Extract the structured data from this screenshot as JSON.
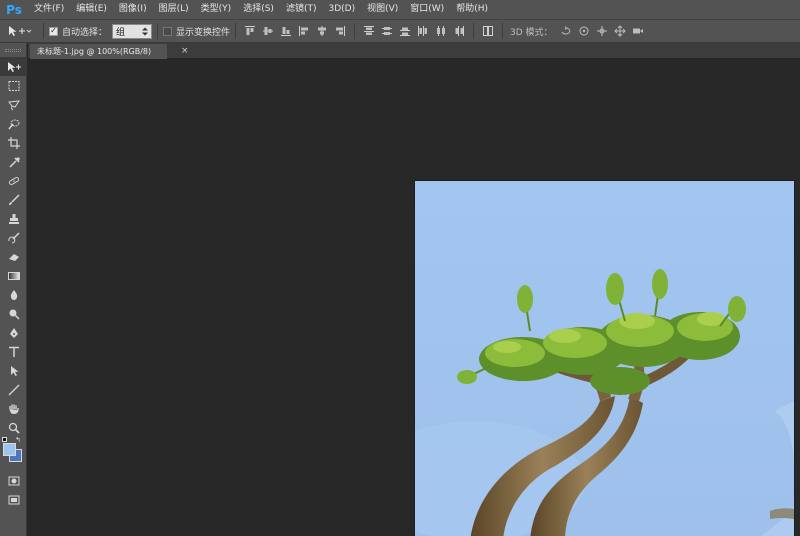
{
  "app": {
    "logo": "Ps",
    "menu": [
      "文件(F)",
      "编辑(E)",
      "图像(I)",
      "图层(L)",
      "类型(Y)",
      "选择(S)",
      "滤镜(T)",
      "3D(D)",
      "视图(V)",
      "窗口(W)",
      "帮助(H)"
    ]
  },
  "options": {
    "auto_select_label": "自动选择：",
    "auto_select_value": "组",
    "show_transform_label": "显示变换控件",
    "mode3d_label": "3D 模式："
  },
  "document": {
    "tab_title": "未标题-1.jpg @ 100%(RGB/8)",
    "close_glyph": "×"
  },
  "colors": {
    "foreground": "#9cc4ee",
    "background": "#4e76ba",
    "ps_brand": "#31a8ff",
    "chrome": "#535353",
    "workspace": "#282828"
  },
  "tools": [
    "move-tool",
    "marquee-tool",
    "lasso-tool",
    "quick-selection-tool",
    "crop-tool",
    "eyedropper-tool",
    "healing-brush-tool",
    "brush-tool",
    "clone-stamp-tool",
    "history-brush-tool",
    "eraser-tool",
    "gradient-tool",
    "blur-tool",
    "dodge-tool",
    "pen-tool",
    "type-tool",
    "path-selection-tool",
    "line-tool",
    "hand-tool",
    "zoom-tool",
    "quick-mask-tool",
    "screen-mode-tool"
  ]
}
